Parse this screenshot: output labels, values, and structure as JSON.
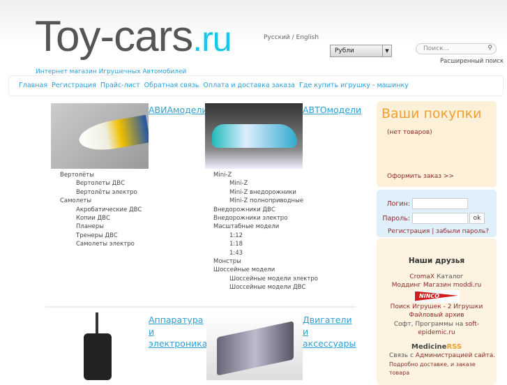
{
  "header": {
    "logo_main": "Toy-cars",
    "logo_tld": ".ru",
    "tagline": "Интернет магазин Игрушечных Автомобилей",
    "language": "Русский / English",
    "currency": "Рубли",
    "search_placeholder": "Поиск...",
    "advanced_search": "Расширенный поиск"
  },
  "nav": [
    "Главная",
    "Регистрация",
    "Прайс-лист",
    "Обратная связь",
    "Оплата и доставка заказа",
    "Где купить игрушку - машинку"
  ],
  "categories": [
    {
      "title": "АВИАмодели",
      "items": [
        {
          "label": "Вертолёты",
          "sub": false
        },
        {
          "label": "Вертолеты ДВС",
          "sub": true
        },
        {
          "label": "Вертолёты электро",
          "sub": true
        },
        {
          "label": "Самолеты",
          "sub": false
        },
        {
          "label": "Акробатические ДВС",
          "sub": true
        },
        {
          "label": "Копии ДВС",
          "sub": true
        },
        {
          "label": "Планеры",
          "sub": true
        },
        {
          "label": "Тренеры ДВС",
          "sub": true
        },
        {
          "label": "Самолеты электро",
          "sub": true
        }
      ]
    },
    {
      "title": "АВТОмодели",
      "items": [
        {
          "label": "Mini-Z",
          "sub": false
        },
        {
          "label": "Mini-Z",
          "sub": true
        },
        {
          "label": "Mini-Z внедорожники",
          "sub": true
        },
        {
          "label": "Mini-Z полноприводные",
          "sub": true
        },
        {
          "label": "Внедорожники ДВС",
          "sub": false
        },
        {
          "label": "Внедорожники электро",
          "sub": false
        },
        {
          "label": "Масштабные модели",
          "sub": false
        },
        {
          "label": "1:12",
          "sub": true
        },
        {
          "label": "1:18",
          "sub": true
        },
        {
          "label": "1:43",
          "sub": true
        },
        {
          "label": "Монстры",
          "sub": false
        },
        {
          "label": "Шоссейные модели",
          "sub": false
        },
        {
          "label": "Шоссейные модели электро",
          "sub": true
        },
        {
          "label": "Шоссейные модели ДВС",
          "sub": true
        }
      ]
    },
    {
      "title": "Аппаратура и электроника",
      "items": []
    },
    {
      "title": "Двигатели и аксессуары",
      "items": []
    }
  ],
  "cart": {
    "title": "Ваши покупки",
    "empty": "(нет товаров)",
    "checkout": "Оформить заказ >>"
  },
  "login": {
    "login_label": "Логин:",
    "password_label": "Пароль:",
    "ok": "ok",
    "register": "Регистрация",
    "forgot": "забыли пароль?",
    "separator": "|"
  },
  "friends": {
    "title": "Наши друзья",
    "cromax": "CromaX",
    "catalog": "Каталог",
    "modding": "Моддинг Магазин moddi.ru",
    "ninco": "NINCO",
    "toys_search": "Поиск Игрушек - 2 Игрушки",
    "archive": "Файловый архив",
    "soft_prefix": "Софт, Программы на",
    "soft_link": "soft-epidemic.ru",
    "medicine": "Medicine",
    "rss": "RSS",
    "contact_prefix": "Связь с",
    "contact_link": "Администрацией сайта.",
    "contact_more": "Подробно доставке, и заказе товара"
  }
}
